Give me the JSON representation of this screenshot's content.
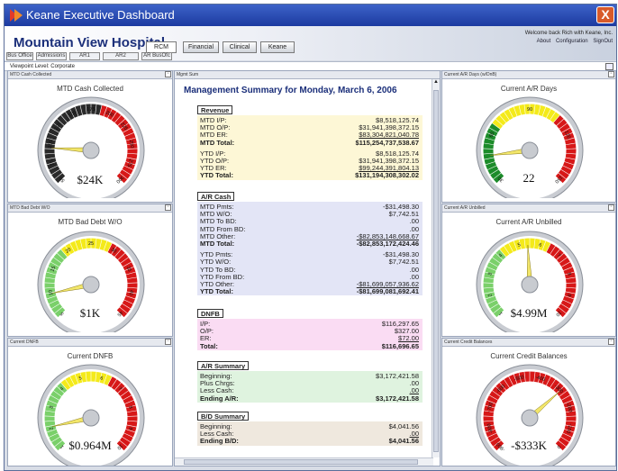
{
  "window": {
    "title": "Keane Executive Dashboard",
    "close_label": "X"
  },
  "header": {
    "hospital": "Mountain View Hospital",
    "welcome": "Welcome back Rich with Keane, Inc.",
    "links": [
      "About",
      "Configuration",
      "SignOut"
    ],
    "tabs": [
      "RCM",
      "Financial",
      "Clinical",
      "Keane"
    ],
    "subtabs": [
      "Bus Office",
      "Admissions",
      "AR1",
      "AR2",
      "AR BusOfc"
    ]
  },
  "viewpoint": "Viewpoint Level: Corporate",
  "panels": {
    "mtd_cash": {
      "header": "MTD Cash Collected",
      "title": "MTD Cash Collected",
      "value": "$24K",
      "ticks": [
        "50",
        "75",
        "100",
        "125",
        "150",
        "175",
        "200",
        "225",
        "250",
        "275",
        "300"
      ],
      "needle_fraction": 0.18
    },
    "mtd_bad_debt": {
      "header": "MTD Bad Debt W/O",
      "title": "MTD Bad Debt W/O",
      "value": "$1K",
      "ticks": [
        "5",
        "10",
        "15",
        "20",
        "25",
        "30",
        "35",
        "40",
        "45"
      ],
      "needle_fraction": 0.12
    },
    "dnfb": {
      "header": "Current DNFB",
      "title": "Current DNFB",
      "value": "$0.964M",
      "ticks": [
        "1",
        "2",
        "3",
        "4",
        "5",
        "6",
        "7",
        "8",
        "9",
        "10"
      ],
      "needle_fraction": 0.12
    },
    "ar_days": {
      "header": "Current A/R Days (w/DnB)",
      "title": "Current A/R Days",
      "value": "22",
      "ticks": [
        "30",
        "60",
        "90",
        "120",
        "150"
      ],
      "needle_fraction": 0.14
    },
    "ar_unbilled": {
      "header": "Current A/R Unbilled",
      "title": "Current A/R Unbilled",
      "value": "$4.99M",
      "ticks": [
        "1",
        "2",
        "3",
        "4",
        "5",
        "6",
        "7",
        "8",
        "9",
        "10"
      ],
      "needle_fraction": 0.49
    },
    "credit_bal": {
      "header": "Current Credit Balances",
      "title": "Current Credit Balances",
      "value": "-$333K",
      "ticks": [
        "-900",
        "-800",
        "-700",
        "-600",
        "-500",
        "-400",
        "-300",
        "-200",
        "-100",
        "0"
      ],
      "needle_fraction": 0.68
    }
  },
  "mgmt": {
    "panel_header": "Mgmt Sum",
    "title": "Management Summary for Monday, March 6, 2006",
    "sections": [
      {
        "name": "Revenue",
        "color": "#fdf7d6",
        "groups": [
          [
            [
              "MTD I/P:",
              "$8,518,125.74"
            ],
            [
              "MTD O/P:",
              "$31,941,398,372.15"
            ],
            [
              "MTD ER:",
              "$83,304,821,040.78"
            ],
            [
              "MTD Total:",
              "$115,254,737,538.67"
            ]
          ],
          [
            [
              "YTD I/P:",
              "$8,518,125.74"
            ],
            [
              "YTD O/P:",
              "$31,941,398,372.15"
            ],
            [
              "YTD ER:",
              "$99,244,391,804.13"
            ],
            [
              "YTD Total:",
              "$131,194,308,302.02"
            ]
          ]
        ]
      },
      {
        "name": "A/R Cash",
        "color": "#e3e5f6",
        "groups": [
          [
            [
              "MTD Pmts:",
              "-$31,498.30"
            ],
            [
              "MTD W/O:",
              "$7,742.51"
            ],
            [
              "MTD To BD:",
              ".00"
            ],
            [
              "MTD From BD:",
              ".00"
            ],
            [
              "MTD Other:",
              "-$82,853,148,668.67"
            ],
            [
              "MTD Total:",
              "-$82,853,172,424.46"
            ]
          ],
          [
            [
              "YTD Pmts:",
              "-$31,498.30"
            ],
            [
              "YTD W/O:",
              "$7,742.51"
            ],
            [
              "YTD To BD:",
              ".00"
            ],
            [
              "YTD From BD:",
              ".00"
            ],
            [
              "YTD Other:",
              "-$81,699,057,936.62"
            ],
            [
              "YTD Total:",
              "-$81,699,081,692.41"
            ]
          ]
        ]
      },
      {
        "name": "DNFB",
        "color": "#fadcf3",
        "groups": [
          [
            [
              "I/P:",
              "$116,297.65"
            ],
            [
              "O/P:",
              "$327.00"
            ],
            [
              "ER:",
              "$72.00"
            ],
            [
              "Total:",
              "$116,696.65"
            ]
          ]
        ]
      },
      {
        "name": "A/R Summary",
        "color": "#dff3df",
        "groups": [
          [
            [
              "Beginning:",
              "$3,172,421.58"
            ],
            [
              "Plus Chrgs:",
              ".00"
            ],
            [
              "Less Cash:",
              ".00"
            ],
            [
              "Ending A/R:",
              "$3,172,421.58"
            ]
          ]
        ]
      },
      {
        "name": "B/D Summary",
        "color": "#efe8de",
        "groups": [
          [
            [
              "Beginning:",
              "$4,041.56"
            ],
            [
              "Less Cash:",
              ".00"
            ],
            [
              "Ending B/D:",
              "$4,041.56"
            ]
          ]
        ]
      }
    ]
  }
}
